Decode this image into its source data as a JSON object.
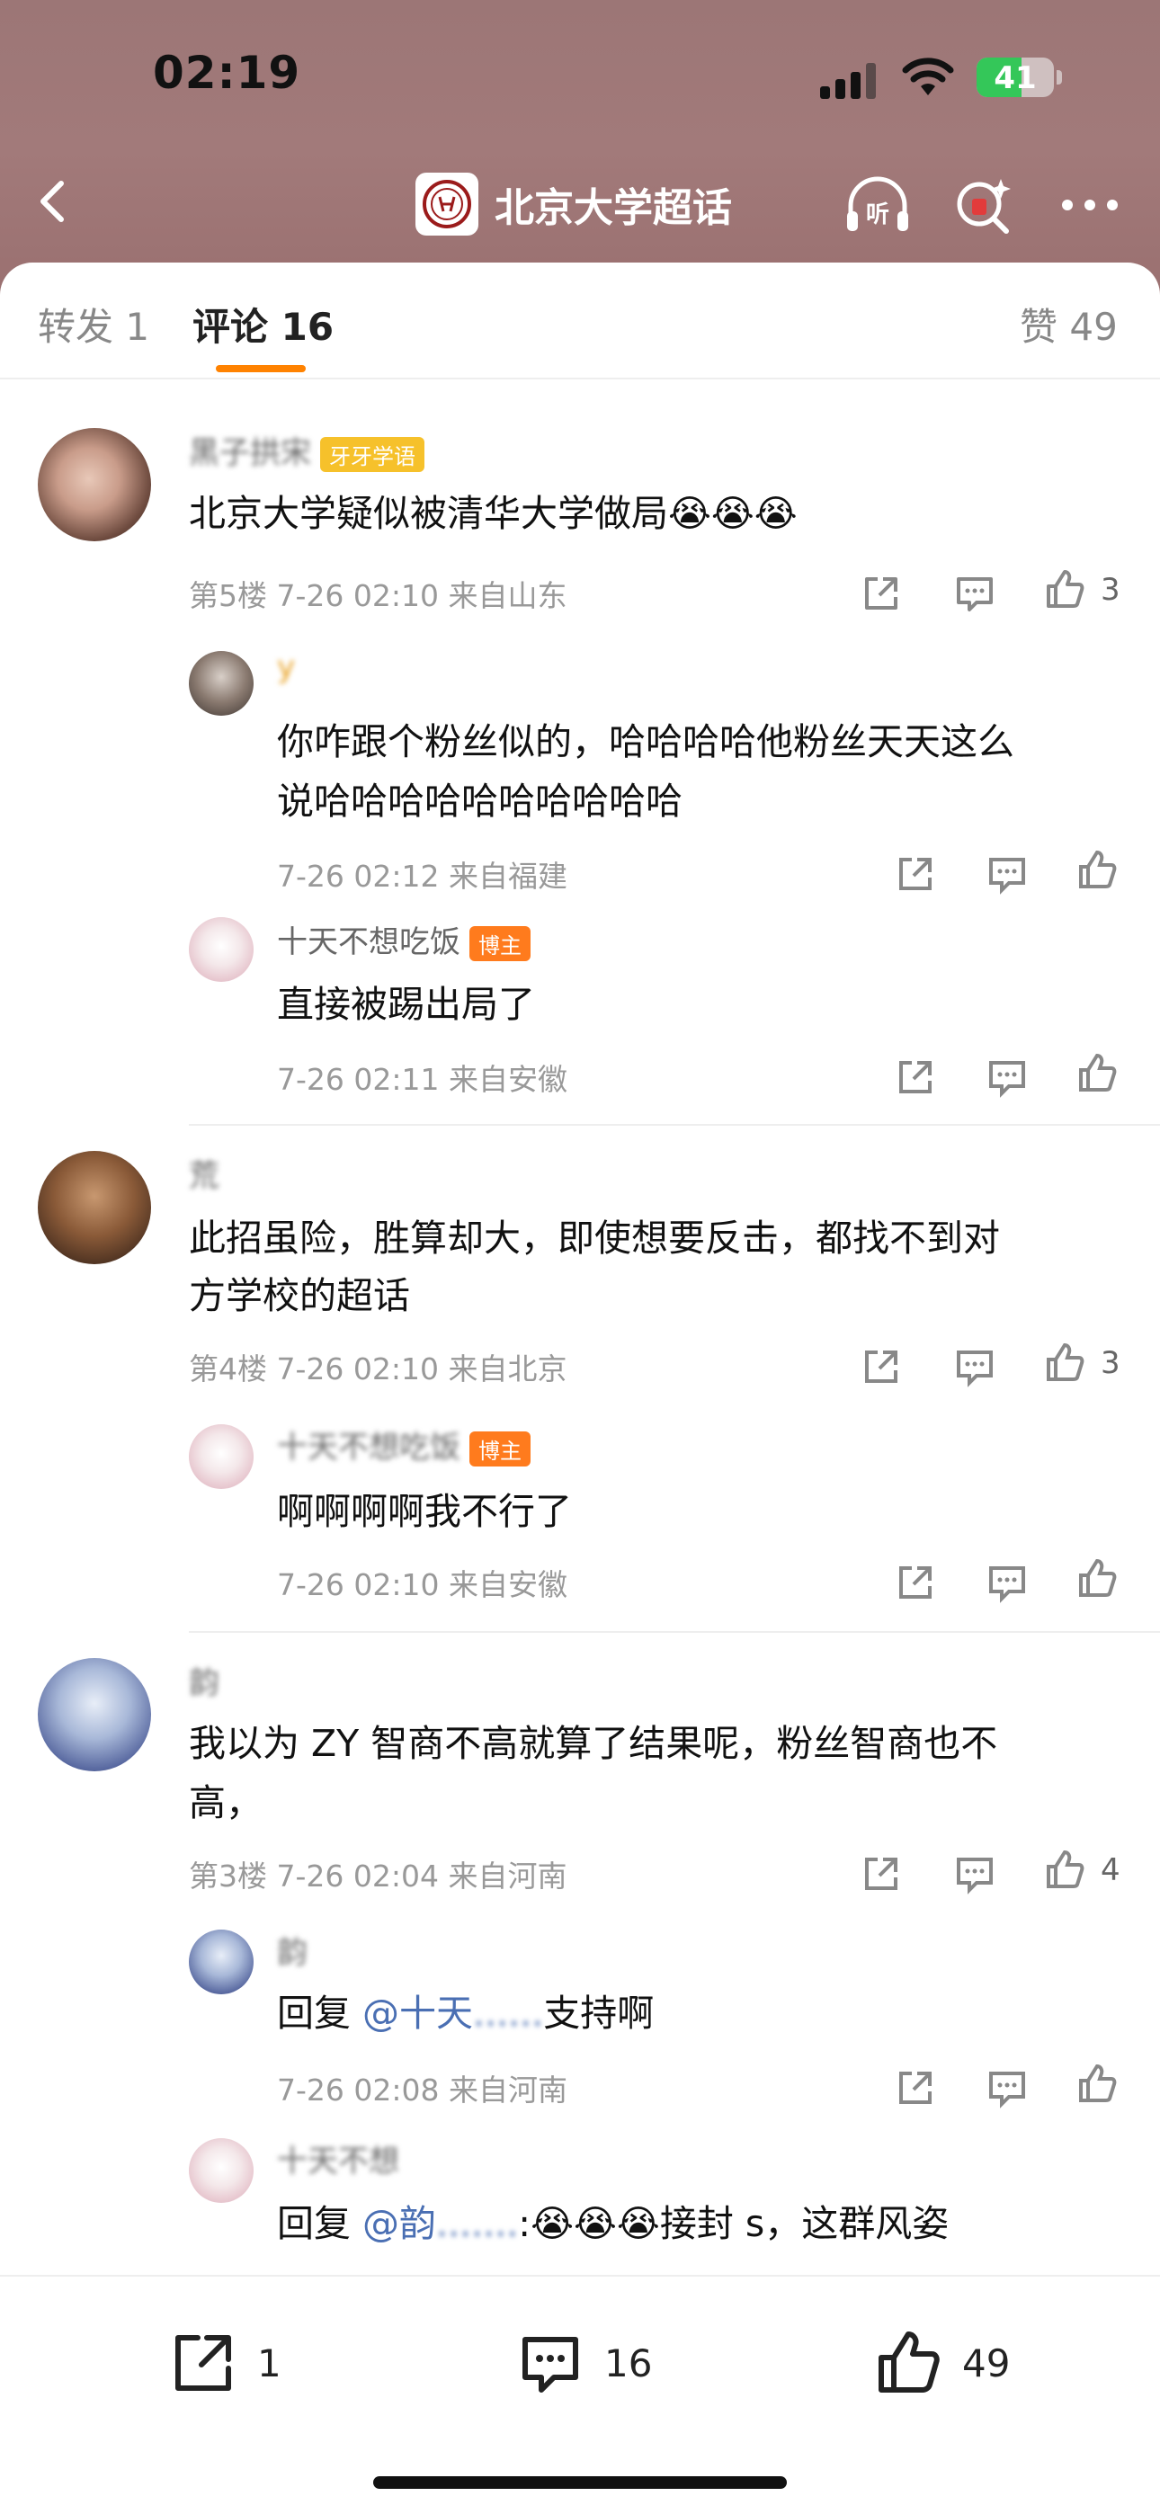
{
  "status": {
    "time": "02:19",
    "battery": "41"
  },
  "nav": {
    "title": "北京大学超话",
    "back_icon": "chevron-left-icon",
    "listen_icon": "headphones-listen-icon",
    "search_icon": "sparkle-search-icon",
    "more_icon": "more-dots-icon"
  },
  "tabs": {
    "repost": "转发 1",
    "comments": "评论 16",
    "likes": "赞 49"
  },
  "comments": [
    {
      "name": "黑子拱宋",
      "badge": "牙牙学语",
      "text": "北京大学疑似被清华大学做局😭😭😭",
      "meta": "第5楼 7-26 02:10 来自山东",
      "likes": "3",
      "replies": [
        {
          "name": "y",
          "text1": "你咋跟个粉丝似的，哈哈哈哈他粉丝天天这么",
          "text2": "说哈哈哈哈哈哈哈哈哈哈",
          "meta": "7-26 02:12 来自福建"
        },
        {
          "name": "十天不想吃饭",
          "badge": "博主",
          "text1": "直接被踢出局了",
          "meta": "7-26 02:11 来自安徽"
        }
      ]
    },
    {
      "name": "荒",
      "text1": "此招虽险，胜算却大，即使想要反击，都找不到对",
      "text2": "方学校的超话",
      "meta": "第4楼 7-26 02:10 来自北京",
      "likes": "3",
      "replies": [
        {
          "name": "十天不想吃饭",
          "badge": "博主",
          "text1": "啊啊啊啊我不行了",
          "meta": "7-26 02:10 来自安徽"
        }
      ]
    },
    {
      "name": "韵",
      "text1": "我以为 ZY 智商不高就算了结果呢，粉丝智商也不",
      "text2": "高，",
      "meta": "第3楼 7-26 02:04 来自河南",
      "likes": "4",
      "replies": [
        {
          "name": "韵",
          "reply_prefix": "回复",
          "mention": "@十天",
          "text_after": "支持啊",
          "meta": "7-26 02:08 来自河南"
        },
        {
          "name": "十天不想",
          "reply_prefix": "回复",
          "mention": "@韵",
          "text_after": ":😭😭😭接封 s，这群风姿"
        }
      ]
    }
  ],
  "bottom": {
    "repost_count": "1",
    "comment_count": "16",
    "like_count": "49"
  }
}
